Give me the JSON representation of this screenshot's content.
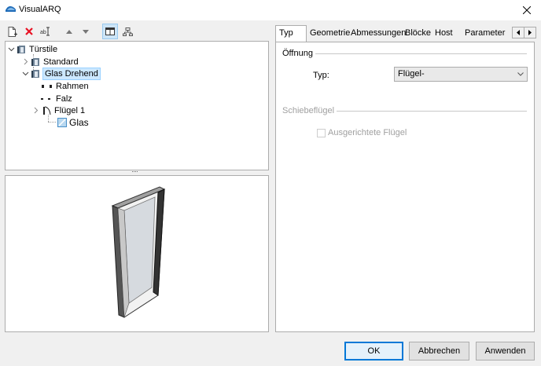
{
  "window": {
    "title": "VisualARQ"
  },
  "toolbar": {
    "items": [
      {
        "name": "new",
        "icon": "new-document-icon"
      },
      {
        "name": "delete",
        "icon": "delete-x-icon"
      },
      {
        "name": "rename",
        "icon": "rename-text-icon"
      },
      {
        "name": "move-up",
        "icon": "arrow-up-icon"
      },
      {
        "name": "move-down",
        "icon": "arrow-down-icon"
      },
      {
        "name": "view-layout",
        "icon": "split-view-icon",
        "active": true
      },
      {
        "name": "hierarchy",
        "icon": "hierarchy-icon"
      }
    ]
  },
  "tree": {
    "root": "Türstile",
    "items": [
      {
        "label": "Standard"
      },
      {
        "label": "Glas Drehend",
        "selected": true,
        "children": [
          "Rahmen",
          "Falz",
          "Flügel 1"
        ]
      },
      {
        "label": "Glas"
      }
    ]
  },
  "tabs": [
    "Typ",
    "Geometrie",
    "Abmessungen",
    "Blöcke",
    "Host",
    "Parameter"
  ],
  "typ_page": {
    "group1_title": "Öffnung",
    "typ_label": "Typ:",
    "typ_value": "Flügel-",
    "group2_title": "Schiebeflügel",
    "aligned_label": "Ausgerichtete Flügel",
    "aligned_checked": false
  },
  "buttons": {
    "ok": "OK",
    "cancel": "Abbrechen",
    "apply": "Anwenden"
  },
  "colors": {
    "accent": "#0078d7",
    "selection": "#cce8ff",
    "delete_red": "#e81123"
  }
}
